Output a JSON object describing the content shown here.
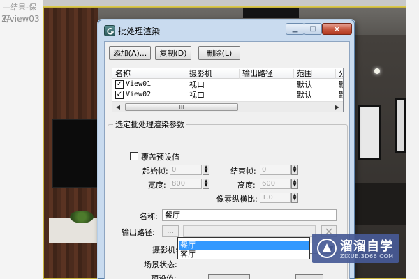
{
  "viewport": {
    "caption_top": "—结果-保存",
    "caption_path": "2/view03"
  },
  "dialog": {
    "title": "批处理渲染",
    "toolbar": {
      "add_label": "添加(A)...",
      "copy_label": "复制(D)",
      "delete_label": "删除(L)"
    },
    "list": {
      "columns": [
        "名称",
        "摄影机",
        "输出路径",
        "范围",
        "分"
      ],
      "rows": [
        {
          "checked": true,
          "name": "View01",
          "camera": "视口",
          "output": "",
          "range": "默认",
          "extra": "默"
        },
        {
          "checked": true,
          "name": "View02",
          "camera": "视口",
          "output": "",
          "range": "默认",
          "extra": "默"
        }
      ],
      "scroll_grip": "III"
    },
    "params": {
      "group_title": "选定批处理渲染参数",
      "override_label": "覆盖预设值",
      "start_frame_label": "起始帧:",
      "start_frame_value": "0",
      "end_frame_label": "结束帧:",
      "end_frame_value": "0",
      "width_label": "宽度:",
      "width_value": "800",
      "height_label": "高度:",
      "height_value": "600",
      "pixel_aspect_label": "像素纵横比:",
      "pixel_aspect_value": "1.0",
      "name_label": "名称:",
      "name_value": "餐厅",
      "output_path_label": "输出路径:",
      "browse_label": "...",
      "camera_label": "摄影机:",
      "camera_value": "------------------------------------------",
      "scene_state_label": "场景状态:",
      "preset_label": "预设值:",
      "dropdown_options": [
        "餐厅",
        "客厅"
      ],
      "dropdown_selected": "餐厅"
    }
  },
  "watermark": {
    "text": "溜溜自学",
    "url": "ZIXUE.3D66.COM"
  },
  "colors": {
    "title_bg": "#c9dbef",
    "close_red": "#c85a42",
    "selection": "#3399ff"
  }
}
